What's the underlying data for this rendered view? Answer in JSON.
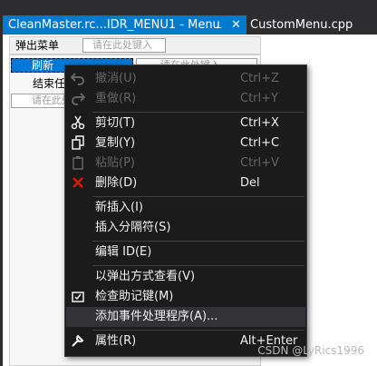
{
  "tabs": {
    "active_title": "CleanMaster.rc...IDR_MENU1 - Menu",
    "pin_icon": "⊥",
    "close_icon": "✕",
    "inactive_title": "CustomMenu.cpp"
  },
  "designer": {
    "menubar_item": "弹出菜单",
    "type_here": "请在此处键入",
    "dropdown_refresh": "刷新",
    "dropdown_end": "结束任",
    "dropdown_type_here": "请在此处键入",
    "submenu_type_here": "请在此处键入"
  },
  "context_menu": {
    "undo": {
      "label": "撤消(U)",
      "shortcut": "Ctrl+Z",
      "icon": "undo-icon"
    },
    "redo": {
      "label": "重做(R)",
      "shortcut": "Ctrl+Y",
      "icon": "redo-icon"
    },
    "cut": {
      "label": "剪切(T)",
      "shortcut": "Ctrl+X",
      "icon": "scissors-icon"
    },
    "copy": {
      "label": "复制(Y)",
      "shortcut": "Ctrl+C",
      "icon": "copy-icon"
    },
    "paste": {
      "label": "粘贴(P)",
      "shortcut": "Ctrl+V",
      "icon": "paste-icon"
    },
    "delete": {
      "label": "删除(D)",
      "shortcut": "Del",
      "icon": "delete-x-icon"
    },
    "insert_new": {
      "label": "新插入(I)"
    },
    "insert_separator": {
      "label": "插入分隔符(S)"
    },
    "edit_id": {
      "label": "编辑 ID(E)"
    },
    "view_as_popup": {
      "label": "以弹出方式查看(V)"
    },
    "check_mnemonics": {
      "label": "检查助记键(M)",
      "icon": "check-mnemonics-icon"
    },
    "add_event_handler": {
      "label": "添加事件处理程序(A)..."
    },
    "properties": {
      "label": "属性(R)",
      "shortcut": "Alt+Enter",
      "icon": "wrench-icon"
    }
  },
  "watermark": "CSDN @LyRics1996",
  "colors": {
    "tab_active": "#007acc",
    "tab_strip": "#2d2d30",
    "menu_bg": "#1b1b1c",
    "menu_hover": "#333337",
    "menu_text": "#f1f1f1",
    "menu_disabled": "#656565",
    "delete_red": "#e51400",
    "designer_highlight": "#0078d7"
  }
}
